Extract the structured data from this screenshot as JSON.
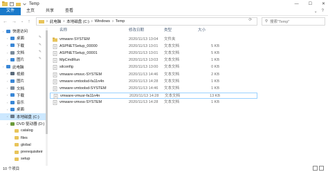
{
  "window": {
    "title": "Temp",
    "minimize": "—",
    "maximize": "☐",
    "close": "✕"
  },
  "ribbon": {
    "tabs": [
      "文件",
      "主页",
      "共享",
      "查看"
    ],
    "help": "?"
  },
  "address": {
    "crumbs": [
      "›",
      "此电脑",
      "›",
      "本地磁盘 (C:)",
      "›",
      "Windows",
      "›",
      "Temp"
    ]
  },
  "search": {
    "placeholder": "搜索\"Temp\""
  },
  "nav": {
    "items": [
      {
        "label": "快速访问",
        "indent": 0,
        "icon": "star-icon",
        "color": "#3a87d6"
      },
      {
        "label": "桌面",
        "indent": 1,
        "icon": "desktop-icon",
        "color": "#3a87d6",
        "pinned": true
      },
      {
        "label": "下载",
        "indent": 1,
        "icon": "download-icon",
        "color": "#3a87d6",
        "pinned": true
      },
      {
        "label": "文档",
        "indent": 1,
        "icon": "document-icon",
        "color": "#7a8a9a",
        "pinned": true
      },
      {
        "label": "图片",
        "indent": 1,
        "icon": "picture-icon",
        "color": "#3a87d6",
        "pinned": true
      },
      {
        "label": "此电脑",
        "indent": 0,
        "icon": "computer-icon",
        "color": "#3a87d6"
      },
      {
        "label": "视频",
        "indent": 1,
        "icon": "video-icon",
        "color": "#5a6a7a"
      },
      {
        "label": "图片",
        "indent": 1,
        "icon": "picture-icon",
        "color": "#3a87d6"
      },
      {
        "label": "文档",
        "indent": 1,
        "icon": "document-icon",
        "color": "#7a8a9a"
      },
      {
        "label": "下载",
        "indent": 1,
        "icon": "download-icon",
        "color": "#3a87d6"
      },
      {
        "label": "音乐",
        "indent": 1,
        "icon": "music-icon",
        "color": "#3a87d6"
      },
      {
        "label": "桌面",
        "indent": 1,
        "icon": "desktop-icon",
        "color": "#3a87d6"
      },
      {
        "label": "本地磁盘 (C:)",
        "indent": 1,
        "icon": "drive-icon",
        "color": "#6a7a8a",
        "selected": true
      },
      {
        "label": "DVD 驱动器 (D:)",
        "indent": 1,
        "icon": "dvd-icon",
        "color": "#6a9a3a"
      },
      {
        "label": "catalog",
        "indent": 2,
        "icon": "folder-icon",
        "color": "#e8c45a"
      },
      {
        "label": "files",
        "indent": 2,
        "icon": "folder-icon",
        "color": "#e8c45a"
      },
      {
        "label": "global",
        "indent": 2,
        "icon": "folder-icon",
        "color": "#e8c45a"
      },
      {
        "label": "prerequisiteir",
        "indent": 2,
        "icon": "folder-icon",
        "color": "#e8c45a"
      },
      {
        "label": "setup",
        "indent": 2,
        "icon": "folder-icon",
        "color": "#e8c45a"
      }
    ]
  },
  "columns": {
    "name": "名称",
    "date": "修改日期",
    "type": "类型",
    "size": "大小"
  },
  "files": [
    {
      "name": "vmware-SYSTEM",
      "date": "2020/11/13 13:04",
      "type": "文件夹",
      "size": "",
      "kind": "folder"
    },
    {
      "name": "ASPNETSetup_00000",
      "date": "2020/11/13 13:01",
      "type": "文本文档",
      "size": "5 KB",
      "kind": "text"
    },
    {
      "name": "ASPNETSetup_00001",
      "date": "2020/11/13 13:01",
      "type": "文本文档",
      "size": "5 KB",
      "kind": "text"
    },
    {
      "name": "MpCmdRun",
      "date": "2020/11/13 13:03",
      "type": "文本文档",
      "size": "1 KB",
      "kind": "text"
    },
    {
      "name": "silconfig",
      "date": "2020/11/13 13:00",
      "type": "文本文档",
      "size": "0 KB",
      "kind": "text"
    },
    {
      "name": "vmware-vmsvc-SYSTEM",
      "date": "2020/11/13 14:46",
      "type": "文本文档",
      "size": "2 KB",
      "kind": "text"
    },
    {
      "name": "vmware-vmtoolsd-fa11n4n",
      "date": "2020/11/13 14:28",
      "type": "文本文档",
      "size": "1 KB",
      "kind": "text"
    },
    {
      "name": "vmware-vmtoolsd-SYSTEM",
      "date": "2020/11/13 14:46",
      "type": "文本文档",
      "size": "1 KB",
      "kind": "text"
    },
    {
      "name": "vmware-vmusr-fa11n4n",
      "date": "2020/11/13 14:28",
      "type": "文本文档",
      "size": "13 KB",
      "kind": "text",
      "selected": true
    },
    {
      "name": "vmware-vmvss-SYSTEM",
      "date": "2020/11/13 14:28",
      "type": "文本文档",
      "size": "1 KB",
      "kind": "text"
    }
  ],
  "status": {
    "count": "10 个项目"
  },
  "colors": {
    "accent": "#1979ca",
    "selection": "#cce8ff",
    "folder": "#e8c45a"
  }
}
